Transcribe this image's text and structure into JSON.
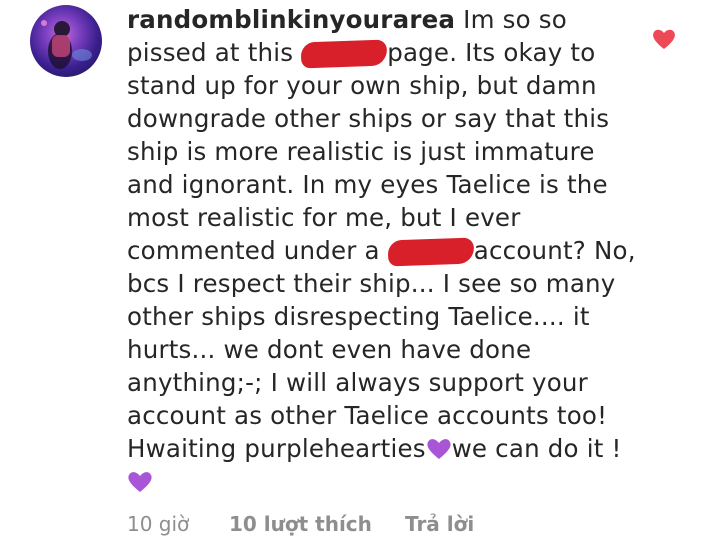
{
  "comment": {
    "username": "randomblinkinyourarea",
    "text_part1": " Im so so pissed at this",
    "text_part2": "page. Its okay to stand up for your own ship, but damn downgrade other ships or say that this ship is more realistic is just immature and ignorant. In my eyes Taelice is the most realistic for me, but I ever commented under a",
    "text_part3": "account? No, bcs I respect their ship... I see so many other ships disrespecting Taelice.... it hurts... we dont even have done anything;-; I will always support your account as other Taelice accounts too! Hwaiting purplehearties",
    "text_part4": "we can do it !",
    "emoji_icon": "purple-heart-icon",
    "redaction_color": "#d8202b"
  },
  "meta": {
    "time": "10 giờ",
    "likes": "10 lượt thích",
    "reply": "Trả lời"
  },
  "like_icon": {
    "name": "heart-icon",
    "color": "#ed4956"
  }
}
